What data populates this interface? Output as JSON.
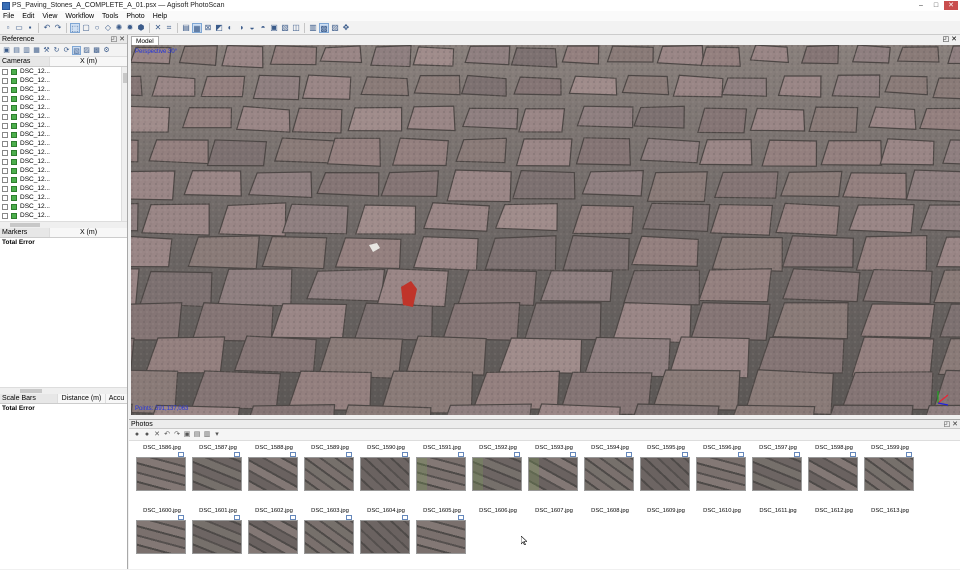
{
  "window": {
    "title": "PS_Paving_Stones_A_COMPLETE_A_01.psx — Agisoft PhotoScan",
    "minimize": "–",
    "maximize": "□",
    "close": "✕"
  },
  "menu": [
    "File",
    "Edit",
    "View",
    "Workflow",
    "Tools",
    "Photo",
    "Help"
  ],
  "reference_panel": {
    "title": "Reference",
    "cameras_header": "Cameras",
    "x_header": "X (m)",
    "cameras": [
      "DSC_12...",
      "DSC_12...",
      "DSC_12...",
      "DSC_12...",
      "DSC_12...",
      "DSC_12...",
      "DSC_12...",
      "DSC_12...",
      "DSC_12...",
      "DSC_12...",
      "DSC_12...",
      "DSC_12...",
      "DSC_12...",
      "DSC_12...",
      "DSC_12...",
      "DSC_12...",
      "DSC_12..."
    ],
    "markers_header": "Markers",
    "markers_x_header": "X (m)",
    "markers_total": "Total Error",
    "scalebars_header": "Scale Bars",
    "distance_header": "Distance (m)",
    "accuracy_header": "Accu",
    "scalebars_total": "Total Error"
  },
  "model_view": {
    "tab": "Model",
    "label": "Perspective 30°",
    "points": "Points: 391,137,063"
  },
  "photos_panel": {
    "title": "Photos",
    "row1": [
      "DSC_1586.jpg",
      "DSC_1587.jpg",
      "DSC_1588.jpg",
      "DSC_1589.jpg",
      "DSC_1590.jpg",
      "DSC_1591.jpg",
      "DSC_1592.jpg",
      "DSC_1593.jpg",
      "DSC_1594.jpg",
      "DSC_1595.jpg",
      "DSC_1596.jpg",
      "DSC_1597.jpg",
      "DSC_1598.jpg",
      "DSC_1599.jpg"
    ],
    "row2": [
      "DSC_1600.jpg",
      "DSC_1601.jpg",
      "DSC_1602.jpg",
      "DSC_1603.jpg",
      "DSC_1604.jpg",
      "DSC_1605.jpg",
      "DSC_1606.jpg",
      "DSC_1607.jpg",
      "DSC_1608.jpg",
      "DSC_1609.jpg",
      "DSC_1610.jpg",
      "DSC_1611.jpg",
      "DSC_1612.jpg",
      "DSC_1613.jpg"
    ]
  },
  "colors": {
    "accent": "#3a6fb6",
    "viewport_text": "#2233dd",
    "camera_icon": "#4cae4c"
  }
}
